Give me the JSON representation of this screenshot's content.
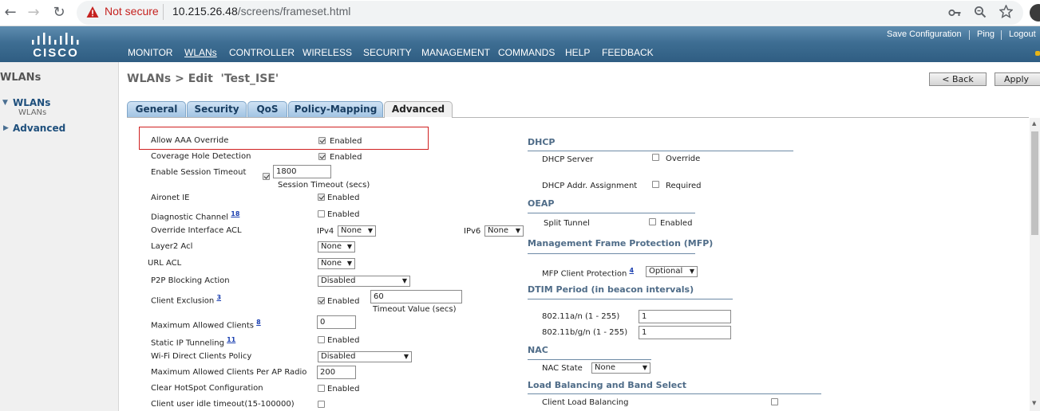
{
  "browser": {
    "not_secure": "Not secure",
    "url_host": "10.215.26.48",
    "url_path": "/screens/frameset.html",
    "back_icon": "←",
    "forward_icon": "→",
    "reload_icon": "↻"
  },
  "header": {
    "brand": "CISCO",
    "menu": [
      "MONITOR",
      "WLANs",
      "CONTROLLER",
      "WIRELESS",
      "SECURITY",
      "MANAGEMENT",
      "COMMANDS",
      "HELP",
      "FEEDBACK"
    ],
    "active_menu": "WLANs",
    "links": [
      "Save Configuration",
      "Ping",
      "Logout"
    ]
  },
  "sidebar": {
    "title": "WLANs",
    "items": [
      {
        "label": "WLANs",
        "sub": "WLANs"
      },
      {
        "label": "Advanced"
      }
    ]
  },
  "page": {
    "title": "WLANs > Edit  'Test_ISE'",
    "back_button": "< Back",
    "apply_button": "Apply"
  },
  "tabs": [
    "General",
    "Security",
    "QoS",
    "Policy-Mapping",
    "Advanced"
  ],
  "active_tab": "Advanced",
  "left": {
    "allow_aaa_override": {
      "label": "Allow AAA Override",
      "cb": "Enabled",
      "checked": true
    },
    "coverage_hole": {
      "label": "Coverage Hole Detection",
      "cb": "Enabled",
      "checked": true
    },
    "session_timeout": {
      "label": "Enable Session Timeout",
      "checked": true,
      "value": "1800",
      "caption": "Session Timeout (secs)"
    },
    "aironet_ie": {
      "label": "Aironet IE",
      "cb": "Enabled",
      "checked": true
    },
    "diagnostic_channel": {
      "label": "Diagnostic Channel",
      "sup": "18",
      "cb": "Enabled",
      "checked": false
    },
    "override_acl": {
      "label": "Override Interface ACL",
      "ipv4_label": "IPv4",
      "ipv4_value": "None",
      "ipv6_label": "IPv6",
      "ipv6_value": "None"
    },
    "layer2_acl": {
      "label": "Layer2 Acl",
      "value": "None"
    },
    "url_acl": {
      "label": "URL ACL",
      "value": "None"
    },
    "p2p_blocking": {
      "label": "P2P Blocking Action",
      "value": "Disabled"
    },
    "client_exclusion": {
      "label": "Client Exclusion",
      "sup": "3",
      "cb": "Enabled",
      "checked": true,
      "value": "60",
      "caption": "Timeout Value (secs)"
    },
    "max_clients": {
      "label": "Maximum Allowed Clients",
      "sup": "8",
      "value": "0"
    },
    "static_ip": {
      "label": "Static IP Tunneling",
      "sup": "11",
      "cb": "Enabled",
      "checked": false
    },
    "wifi_direct": {
      "label": "Wi-Fi Direct Clients Policy",
      "value": "Disabled"
    },
    "max_clients_ap": {
      "label": "Maximum Allowed Clients Per AP Radio",
      "value": "200"
    },
    "clear_hotspot": {
      "label": "Clear HotSpot Configuration",
      "cb": "Enabled",
      "checked": false
    },
    "idle_timeout": {
      "label": "Client user idle timeout(15-100000)",
      "checked": false
    }
  },
  "right": {
    "dhcp": {
      "title": "DHCP",
      "server_label": "DHCP Server",
      "server_cb": "Override",
      "assign_label": "DHCP Addr. Assignment",
      "assign_cb": "Required"
    },
    "oeap": {
      "title": "OEAP",
      "split_label": "Split Tunnel",
      "split_cb": "Enabled"
    },
    "mfp": {
      "title": "Management Frame Protection (MFP)",
      "label": "MFP Client Protection",
      "sup": "4",
      "value": "Optional"
    },
    "dtim": {
      "title": "DTIM Period (in beacon intervals)",
      "a_label": "802.11a/n (1 - 255)",
      "a_value": "1",
      "b_label": "802.11b/g/n (1 - 255)",
      "b_value": "1"
    },
    "nac": {
      "title": "NAC",
      "label": "NAC State",
      "value": "None"
    },
    "lb": {
      "title": "Load Balancing and Band Select",
      "label": "Client Load Balancing"
    }
  }
}
